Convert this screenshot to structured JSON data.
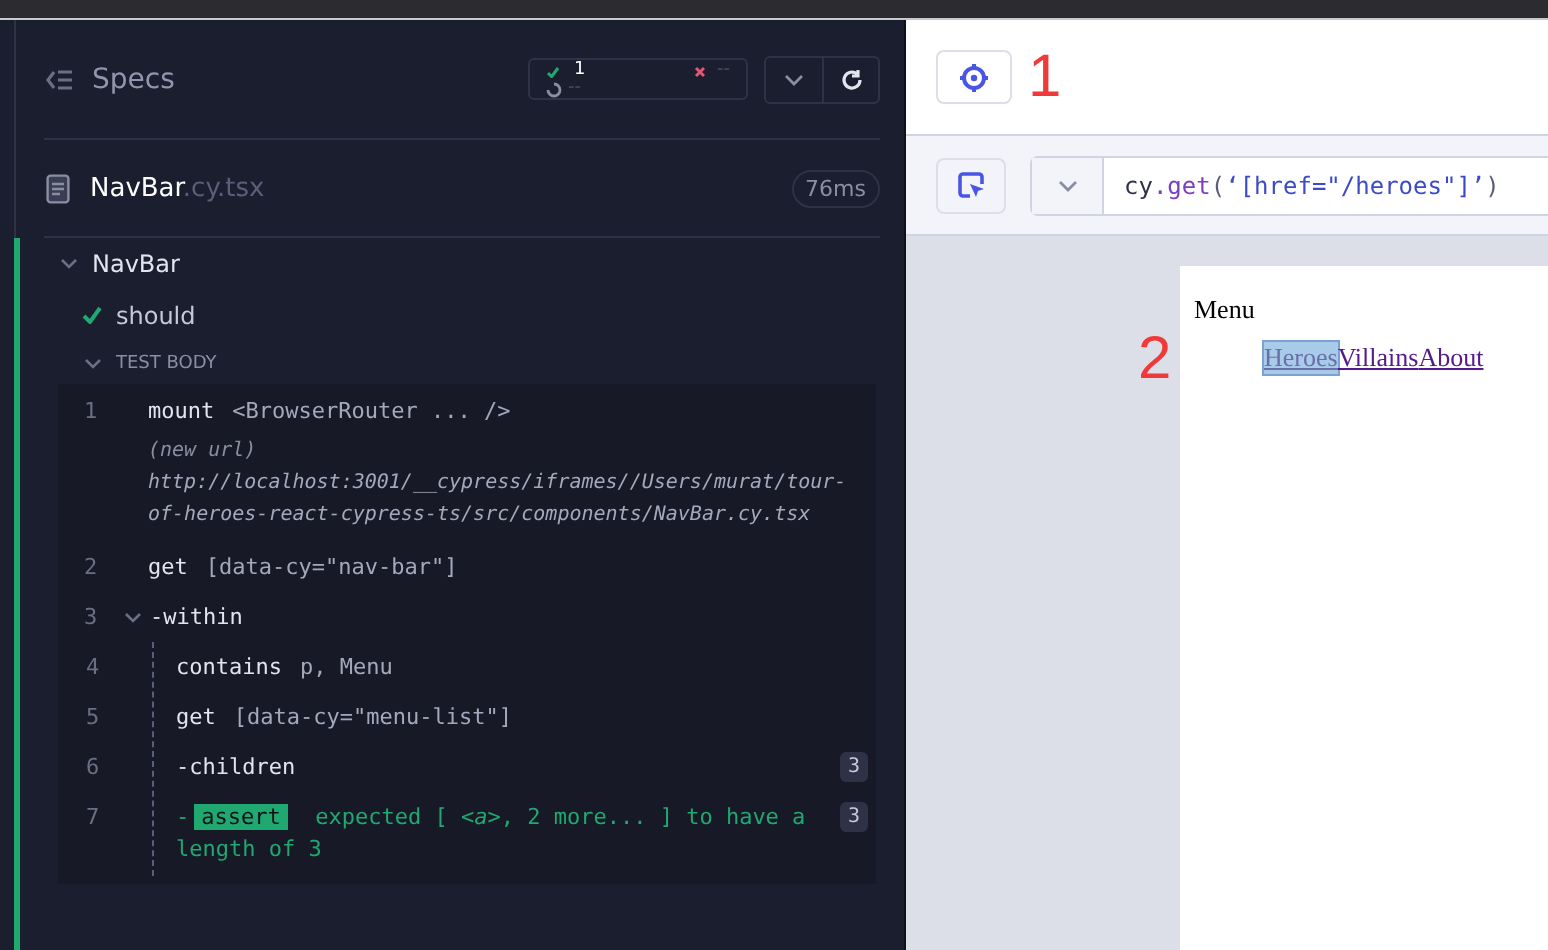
{
  "header": {
    "title": "Specs",
    "passed": "1",
    "failed": "--",
    "pending": "--"
  },
  "spec": {
    "name": "NavBar",
    "extension": ".cy.tsx",
    "duration": "76ms"
  },
  "suite": {
    "title": "NavBar",
    "expanded": true
  },
  "test": {
    "title": "should",
    "passed": true
  },
  "section": {
    "title": "TEST BODY",
    "expanded": true
  },
  "commands": [
    {
      "kind": "command",
      "number": "1",
      "name": "mount",
      "message": "<BrowserRouter ... />"
    },
    {
      "kind": "event",
      "label": "(new url)",
      "message": "http://localhost:3001/__cypress/iframes//Users/murat/tour-of-heroes-react-cypress-ts/src/components/NavBar.cy.tsx"
    },
    {
      "kind": "command",
      "number": "2",
      "name": "get",
      "message": "[data-cy=\"nav-bar\"]"
    },
    {
      "kind": "command",
      "number": "3",
      "prefix": "-",
      "name": "within",
      "expanded": true,
      "children": [
        {
          "kind": "command",
          "number": "4",
          "name": "contains",
          "message": "p, Menu"
        },
        {
          "kind": "command",
          "number": "5",
          "name": "get",
          "message": "[data-cy=\"menu-list\"]"
        },
        {
          "kind": "command",
          "number": "6",
          "prefix": "-",
          "name": "children",
          "count": "3"
        },
        {
          "kind": "assert",
          "number": "7",
          "prefix": "-",
          "name": "assert",
          "message": "expected [ *<a>*, 2 more... ] to have a length of 3",
          "count": "3"
        }
      ]
    }
  ],
  "annotations": [
    {
      "label": "1"
    },
    {
      "label": "2"
    }
  ],
  "selector": {
    "parts": [
      {
        "kind": "object",
        "text": "cy"
      },
      {
        "kind": "method",
        "text": ".get"
      },
      {
        "kind": "punct",
        "text": "("
      },
      {
        "kind": "string",
        "text": "‘[href=\"/heroes\"]’"
      },
      {
        "kind": "punct",
        "text": ")"
      }
    ]
  },
  "app": {
    "heading": "Menu",
    "links": [
      {
        "label": "Heroes",
        "selected": true
      },
      {
        "label": "Villains",
        "selected": false
      },
      {
        "label": "About",
        "selected": false
      }
    ]
  }
}
